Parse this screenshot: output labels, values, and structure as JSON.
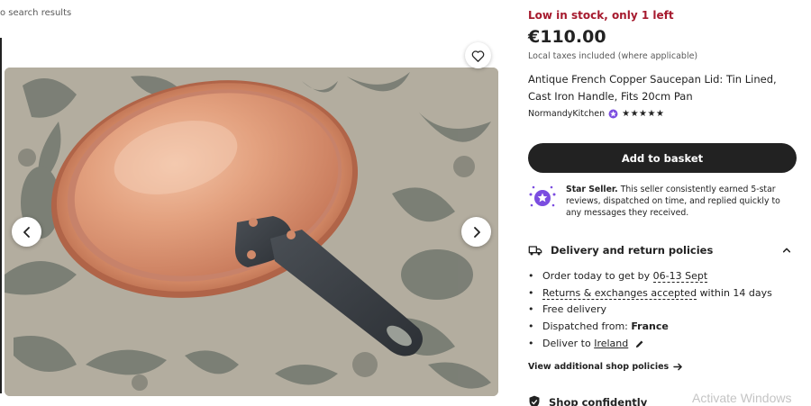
{
  "nav": {
    "back_label": "o search results"
  },
  "product": {
    "stock_status": "Low in stock, only 1 left",
    "price": "€110.00",
    "tax_note": "Local taxes included (where applicable)",
    "title": "Antique French Copper Saucepan Lid: Tin Lined, Cast Iron Handle, Fits 20cm Pan",
    "shop_name": "NormandyKitchen",
    "rating_stars": "★★★★★",
    "rating_value": 5,
    "add_to_basket_label": "Add to basket"
  },
  "star_seller": {
    "title": "Star Seller.",
    "description": "This seller consistently earned 5-star reviews, dispatched on time, and replied quickly to any messages they received."
  },
  "policies": {
    "header": "Delivery and return policies",
    "order_prefix": "Order today to get by",
    "order_dates": "06-13 Sept",
    "returns_link": "Returns & exchanges accepted",
    "returns_suffix": "within 14 days",
    "free_delivery": "Free delivery",
    "dispatched_prefix": "Dispatched from:",
    "dispatched_country": "France",
    "deliver_prefix": "Deliver to",
    "deliver_country": "Ireland",
    "view_more": "View additional shop policies"
  },
  "shop_confidently": {
    "header": "Shop confidently"
  },
  "watermark": "Activate Windows",
  "icons": {
    "favorite": "heart-outline-icon",
    "prev": "chevron-left-icon",
    "next": "chevron-right-icon",
    "star_seller_badge": "star-seller-badge-icon",
    "delivery": "truck-icon",
    "collapse": "chevron-up-icon",
    "edit": "pencil-icon",
    "arrow": "arrow-right-icon",
    "shield": "shield-check-icon"
  },
  "colors": {
    "stock_red": "#a61a2e",
    "button_bg": "#222222",
    "star_seller_purple": "#7b4de0"
  }
}
